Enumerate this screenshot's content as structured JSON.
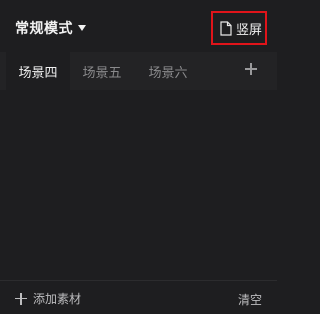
{
  "header": {
    "mode_label": "常规模式",
    "orientation_label": "竖屏"
  },
  "tabs": [
    {
      "label": "场景四",
      "active": true
    },
    {
      "label": "场景五",
      "active": false
    },
    {
      "label": "场景六",
      "active": false
    }
  ],
  "footer": {
    "add_material_label": "添加素材",
    "clear_label": "清空"
  },
  "colors": {
    "background": "#1e1e20",
    "tabbar": "#232325",
    "highlight_border": "#e0141a",
    "text_primary": "#f0f0f0",
    "text_muted": "#8a8a8c"
  },
  "icons": [
    "caret-down-icon",
    "portrait-page-icon",
    "plus-icon"
  ]
}
